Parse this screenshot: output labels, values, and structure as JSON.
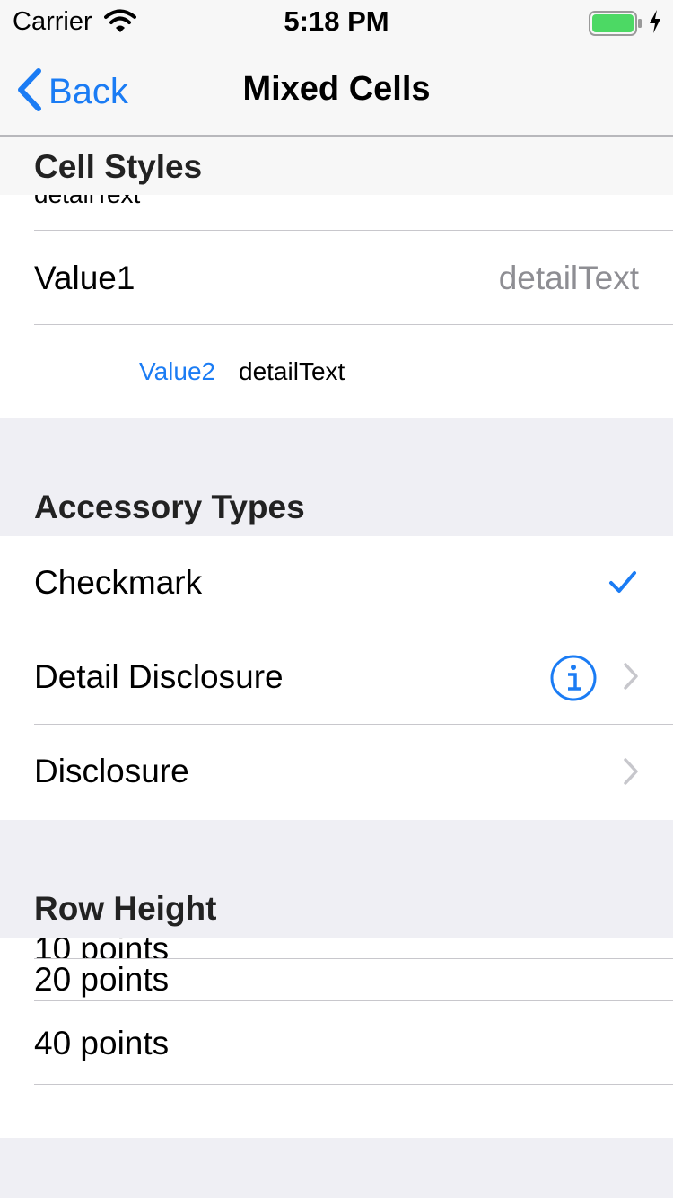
{
  "status_bar": {
    "carrier": "Carrier",
    "time": "5:18 PM"
  },
  "nav": {
    "back_label": "Back",
    "title": "Mixed Cells"
  },
  "sections": {
    "cell_styles": {
      "header": "Cell Styles",
      "partial_row": "detailText",
      "value1": {
        "text": "Value1",
        "detail": "detailText"
      },
      "value2": {
        "text": "Value2",
        "detail": "detailText"
      }
    },
    "accessory_types": {
      "header": "Accessory Types",
      "checkmark": "Checkmark",
      "detail_disclosure": "Detail Disclosure",
      "disclosure": "Disclosure"
    },
    "row_height": {
      "header": "Row Height",
      "rows": [
        "10 points",
        "20 points",
        "40 points"
      ]
    }
  },
  "colors": {
    "accent": "#1b7cf4",
    "separator": "#c8c7cc",
    "background": "#efeff4",
    "detail": "#8e8e93"
  }
}
